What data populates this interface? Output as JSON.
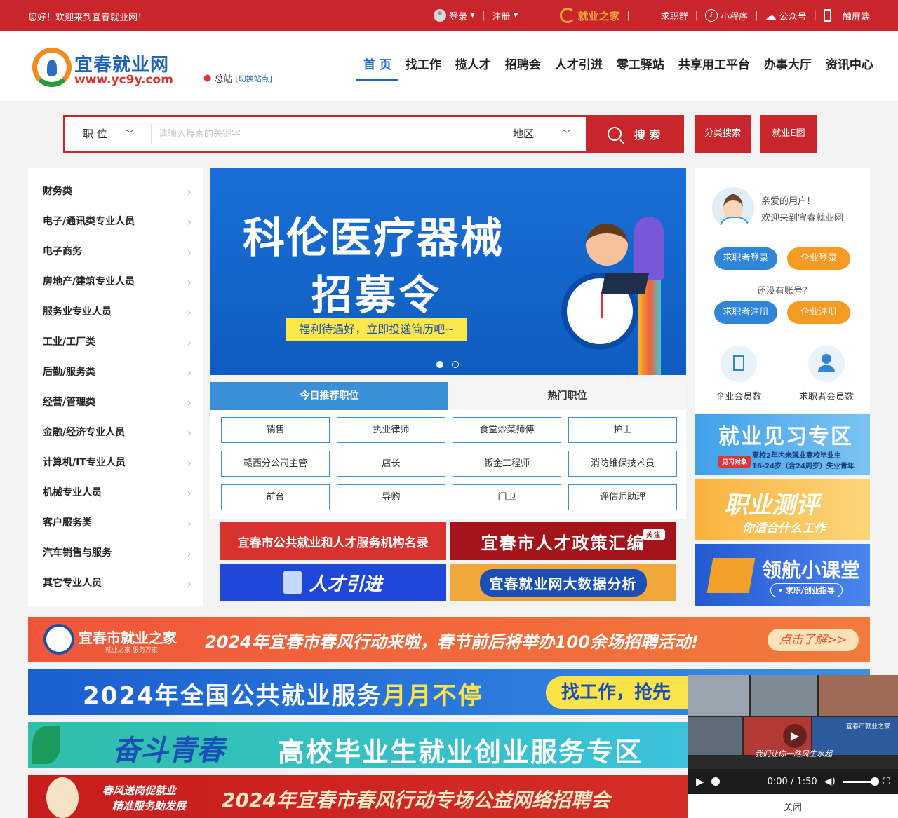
{
  "topbar": {
    "greeting": "您好！欢迎来到宜春就业网！",
    "login": "登录",
    "register": "注册",
    "brand": "就业之家",
    "qiuzhiqun": "求职群",
    "miniprogram": "小程序",
    "gongzhonghao": "公众号",
    "touch": "触屏端"
  },
  "header": {
    "logo_name": "宜春就业网",
    "logo_url": "www.yc9y.com",
    "site": "总站",
    "switch": "[切换站点]"
  },
  "nav": [
    "首 页",
    "找工作",
    "揽人才",
    "招聘会",
    "人才引进",
    "零工驿站",
    "共享用工平台",
    "办事大厅",
    "资讯中心"
  ],
  "search": {
    "category": "职 位",
    "placeholder": "请输入搜索的关键字",
    "area": "地区",
    "button": "搜 索",
    "classify": "分类搜索",
    "map": "就业E图"
  },
  "categories": [
    "财务类",
    "电子/通讯类专业人员",
    "电子商务",
    "房地产/建筑专业人员",
    "服务业专业人员",
    "工业/工厂类",
    "后勤/服务类",
    "经营/管理类",
    "金融/经济专业人员",
    "计算机/IT专业人员",
    "机械专业人员",
    "客户服务类",
    "汽车销售与服务",
    "其它专业人员"
  ],
  "banner": {
    "title1": "科伦医疗器械",
    "title2": "招募令",
    "subtitle": "福利待遇好，立即投递简历吧~"
  },
  "jobs": {
    "tab_recommend": "今日推荐职位",
    "tab_hot": "热门职位",
    "items": [
      "销售",
      "执业律师",
      "食堂炒菜师傅",
      "护士",
      "赣西分公司主管",
      "店长",
      "钣金工程师",
      "消防维保技术员",
      "前台",
      "导购",
      "门卫",
      "评估师助理"
    ]
  },
  "promos": {
    "p1": "宜春市公共就业和人才服务机构名录",
    "p2": "宜春市人才政策汇编",
    "p2_badge": "关注",
    "p3": "人才引进",
    "p4": "宜春就业网大数据分析"
  },
  "user": {
    "hello": "亲爱的用户!",
    "welcome": "欢迎来到宜春就业网",
    "seeker_login": "求职者登录",
    "company_login": "企业登录",
    "no_account": "还没有账号?",
    "seeker_register": "求职者注册",
    "company_register": "企业注册",
    "company_count_label": "企业会员数",
    "seeker_count_label": "求职者会员数"
  },
  "side_ads": {
    "internship_title": "就业见习专区",
    "internship_tag": "见习对象",
    "internship_desc1": "离校2年内未就业高校毕业生",
    "internship_desc2": "16-24岁（含24周岁）失业青年",
    "career_title": "职业测评",
    "career_sub": "你适合什么工作",
    "class_title": "领航小课堂",
    "class_sub": "• 求职/创业指导"
  },
  "wide_banners": {
    "b1_brand": "宜春市就业之家",
    "b1_brand_sub": "就业之家 服务万家",
    "b1_text": "2024年宜春市春风行动来啦，春节前后将举办100余场招聘活动!",
    "b1_btn": "点击了解>>",
    "b2_text1": "2024年全国公共就业服务",
    "b2_text2": "月月不停",
    "b2_pill": "找工作，抢先",
    "b3_left": "奋斗青春",
    "b3_text": "高校毕业生就业创业服务专区",
    "b4_left1": "春风送岗促就业",
    "b4_left2": "精准服务助发展",
    "b4_text": "2024年宜春市春风行动专场公益网络招聘会"
  },
  "video": {
    "caption": "我们让你一路风生水起",
    "logo": "宜春市就业之家",
    "time": "0:00 / 1:50",
    "close": "关闭"
  },
  "colors": {
    "brand_red": "#c8262b",
    "nav_blue": "#1a66c1",
    "tab_blue": "#3a8fd6",
    "orange": "#f59a23"
  }
}
